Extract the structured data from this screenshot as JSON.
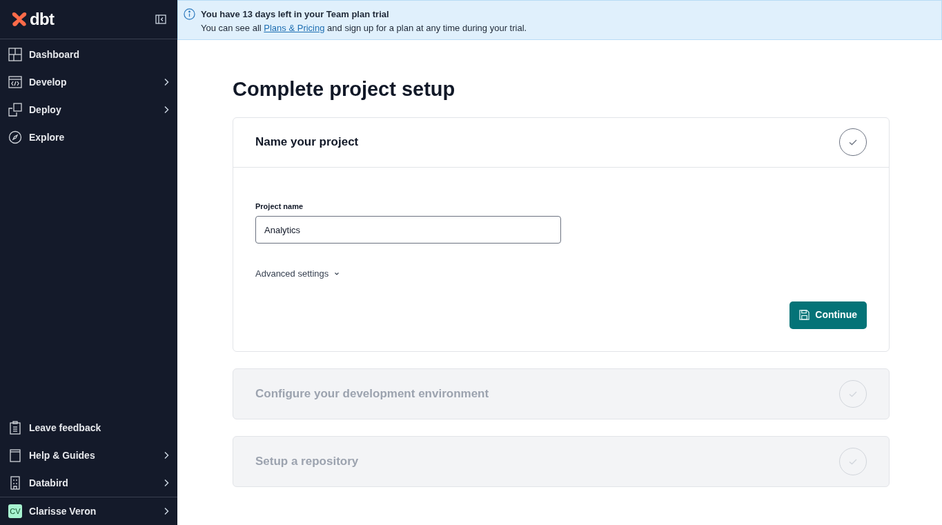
{
  "sidebar": {
    "logo": "dbt",
    "nav_items": [
      {
        "label": "Dashboard",
        "has_submenu": false
      },
      {
        "label": "Develop",
        "has_submenu": true
      },
      {
        "label": "Deploy",
        "has_submenu": true
      },
      {
        "label": "Explore",
        "has_submenu": false
      }
    ],
    "bottom_items": [
      {
        "label": "Leave feedback",
        "has_submenu": false
      },
      {
        "label": "Help & Guides",
        "has_submenu": true
      },
      {
        "label": "Databird",
        "has_submenu": true
      }
    ],
    "user": {
      "initials": "CV",
      "name": "Clarisse Veron",
      "has_submenu": true
    }
  },
  "banner": {
    "title": "You have 13 days left in your Team plan trial",
    "text_before": "You can see all",
    "link": "Plans & Pricing",
    "text_after": "and sign up for a plan at any time during your trial."
  },
  "page_title": "Complete project setup",
  "steps": [
    {
      "title": "Name your project",
      "expanded": true,
      "field_label": "Project name",
      "field_value": "Analytics",
      "advanced": "Advanced settings",
      "button": "Continue"
    },
    {
      "title": "Configure your development environment",
      "expanded": false
    },
    {
      "title": "Setup a repository",
      "expanded": false
    }
  ]
}
